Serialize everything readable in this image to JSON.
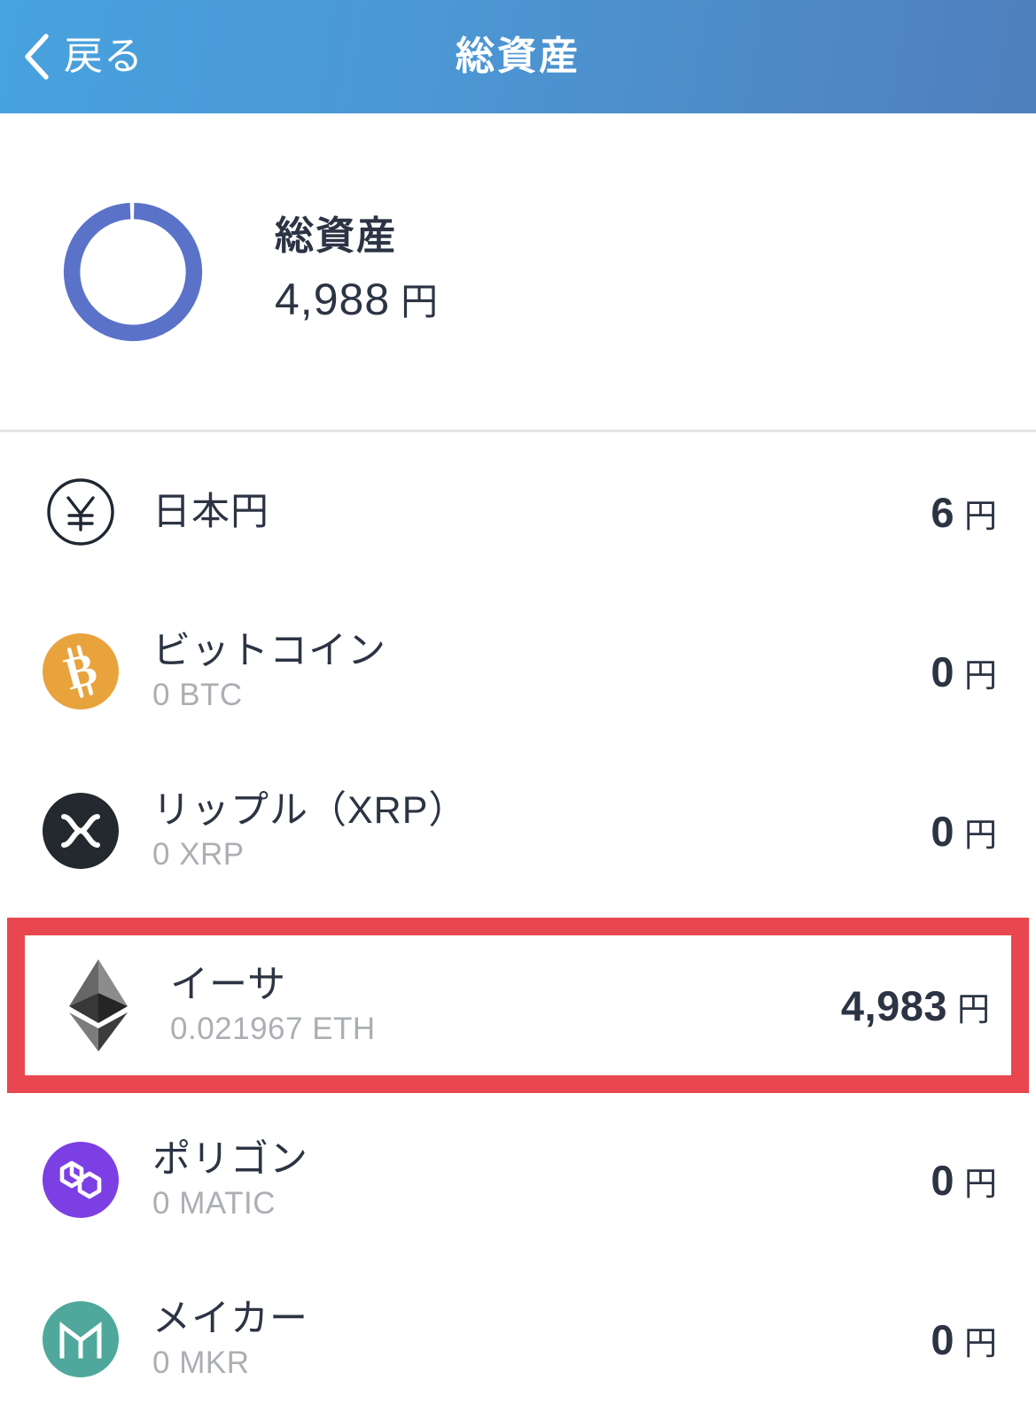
{
  "header": {
    "back_label": "戻る",
    "back_icon": "chevron-left-icon",
    "title": "総資産",
    "gradient_from": "#47a2de",
    "gradient_to": "#4f7fbd"
  },
  "summary": {
    "donut_icon": "donut-chart-icon",
    "donut_color": "#5a72c8",
    "donut_filled_percent": 99,
    "label": "総資産",
    "amount": "4,988",
    "unit": "円"
  },
  "assets": [
    {
      "icon": "jpy-coin-icon",
      "icon_style": "outline-circle",
      "icon_bg": "#ffffff",
      "icon_fg": "#1f2733",
      "name": "日本円",
      "sub": "",
      "value": "6",
      "unit": "円",
      "highlighted": false
    },
    {
      "icon": "bitcoin-icon",
      "icon_style": "filled-circle",
      "icon_bg": "#e8a33d",
      "icon_fg": "#ffffff",
      "name": "ビットコイン",
      "sub": "0 BTC",
      "value": "0",
      "unit": "円",
      "highlighted": false
    },
    {
      "icon": "xrp-icon",
      "icon_style": "filled-circle",
      "icon_bg": "#23292f",
      "icon_fg": "#ffffff",
      "name": "リップル（XRP）",
      "sub": "0 XRP",
      "value": "0",
      "unit": "円",
      "highlighted": false
    },
    {
      "icon": "ethereum-icon",
      "icon_style": "plain",
      "icon_bg": "#ffffff",
      "icon_fg": "#3c3c3d",
      "name": "イーサ",
      "sub": "0.021967 ETH",
      "value": "4,983",
      "unit": "円",
      "highlighted": true
    },
    {
      "icon": "polygon-icon",
      "icon_style": "filled-circle",
      "icon_bg": "#7b3fe4",
      "icon_fg": "#ffffff",
      "name": "ポリゴン",
      "sub": "0 MATIC",
      "value": "0",
      "unit": "円",
      "highlighted": false
    },
    {
      "icon": "maker-icon",
      "icon_style": "filled-circle",
      "icon_bg": "#4fa89b",
      "icon_fg": "#ffffff",
      "name": "メイカー",
      "sub": "0 MKR",
      "value": "0",
      "unit": "円",
      "highlighted": false
    }
  ],
  "colors": {
    "highlight_border": "#e8474f",
    "text_primary": "#2c3444",
    "text_secondary": "#abafb3",
    "divider": "#e4e5e7"
  }
}
